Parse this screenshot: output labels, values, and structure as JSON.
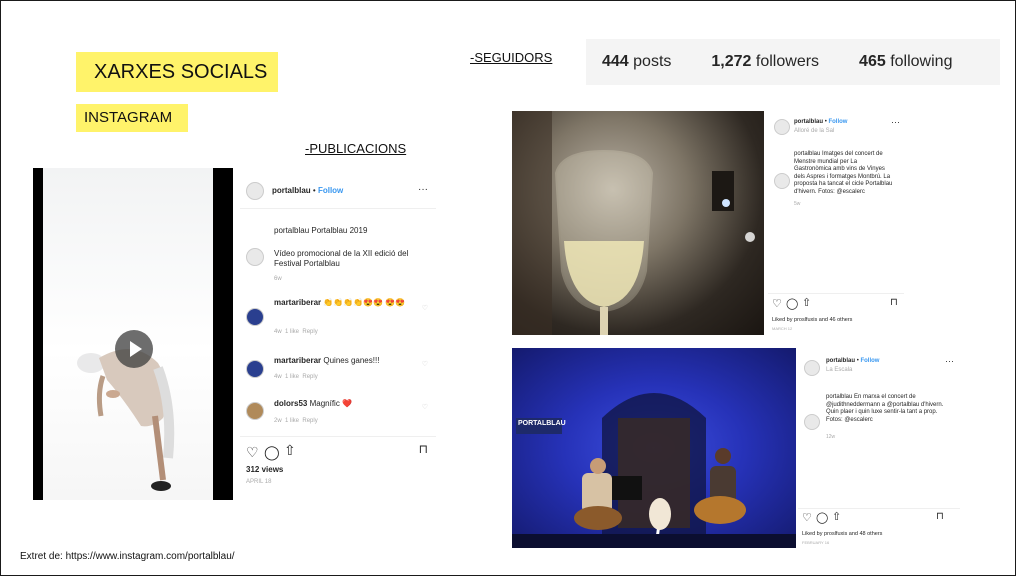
{
  "slide": {
    "title": "XARXES SOCIALS",
    "subtitle": "INSTAGRAM",
    "publicacions_label": "-PUBLICACIONS",
    "seguidors_label": "-SEGUIDORS",
    "source": "Extret de: https://www.instagram.com/portalblau/"
  },
  "profile_stats": {
    "posts_count": "444",
    "posts_label": "posts",
    "followers_count": "1,272",
    "followers_label": "followers",
    "following_count": "465",
    "following_label": "following"
  },
  "post1": {
    "username": "portalblau",
    "dot": "•",
    "follow": "Follow",
    "caption_title": "portalblau Portalblau 2019",
    "caption_text": "Vídeo promocional de la XII edició del Festival Portalblau",
    "caption_age": "6w",
    "comments": [
      {
        "user": "martariberar",
        "text": "👏👏👏👏😍😍 😍😍",
        "age": "4w",
        "likes": "1 like",
        "reply": "Reply"
      },
      {
        "user": "martariberar",
        "text": "Quines ganes!!!",
        "age": "4w",
        "likes": "1 like",
        "reply": "Reply"
      },
      {
        "user": "dolors53",
        "text": "Magnífic ❤️",
        "age": "2w",
        "likes": "1 like",
        "reply": "Reply"
      }
    ],
    "views": "312 views",
    "date": "APRIL 18"
  },
  "post2": {
    "username": "portalblau",
    "dot": "•",
    "follow": "Follow",
    "location": "Alloré de la Sal",
    "caption": "portalblau Imatges del concert de Menstre mundial per La Gastronòmica amb vins de Vinyes dels Aspres i formatges Montbrú. La proposta ha tancat el cicle Portalblau d'hivern. Fotos: @escalerc",
    "age": "5w",
    "likes": "Liked by proslfuxis and 46 others",
    "date": "MARCH 12"
  },
  "post3": {
    "username": "portalblau",
    "dot": "•",
    "follow": "Follow",
    "location": "La Escala",
    "caption": "portalblau En marxa el concert de @judithneddermann a @portalblau d'hivern. Quin plaer i quin luxe sentir-la tant a prop. Fotos: @escalerc",
    "age": "12w",
    "likes": "Liked by proslfuxis and 48 others",
    "date": "FEBRUARY 16",
    "banner": "PORTALBLAU"
  }
}
